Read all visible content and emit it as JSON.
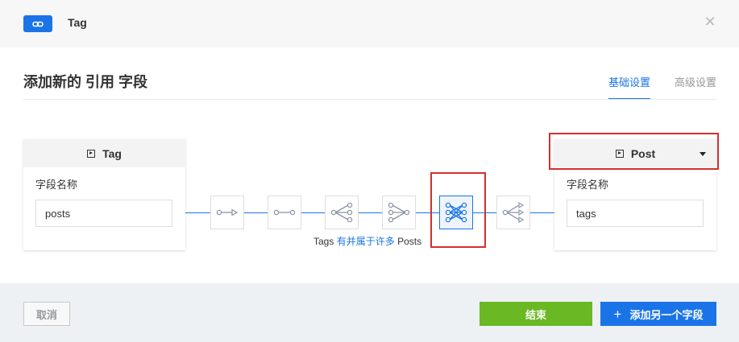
{
  "header": {
    "title": "Tag",
    "link_icon": "link-icon",
    "close_icon": "close-icon"
  },
  "dialog": {
    "subtitle": "添加新的 引用 字段",
    "tabs": [
      {
        "label": "基础设置",
        "active": true
      },
      {
        "label": "高级设置",
        "active": false
      }
    ]
  },
  "left_panel": {
    "model_name": "Tag",
    "field_label": "字段名称",
    "field_value": "posts"
  },
  "right_panel": {
    "model_name": "Post",
    "field_label": "字段名称",
    "field_value": "tags"
  },
  "relations": {
    "options": [
      {
        "icon": "one-way-reference-icon",
        "selected": false
      },
      {
        "icon": "one-to-one-icon",
        "selected": false
      },
      {
        "icon": "one-to-many-icon",
        "selected": false
      },
      {
        "icon": "many-to-one-icon",
        "selected": false
      },
      {
        "icon": "many-to-many-icon",
        "selected": true
      },
      {
        "icon": "one-way-many-icon",
        "selected": false
      }
    ],
    "caption_start": "Tags",
    "caption_mid": "有并属于许多",
    "caption_end": "Posts"
  },
  "footer": {
    "cancel_label": "取消",
    "finish_label": "结束",
    "add_label": "添加另一个字段"
  },
  "colors": {
    "accent": "#1a74e8",
    "success": "#6ab824",
    "highlight": "#d32f2f"
  }
}
